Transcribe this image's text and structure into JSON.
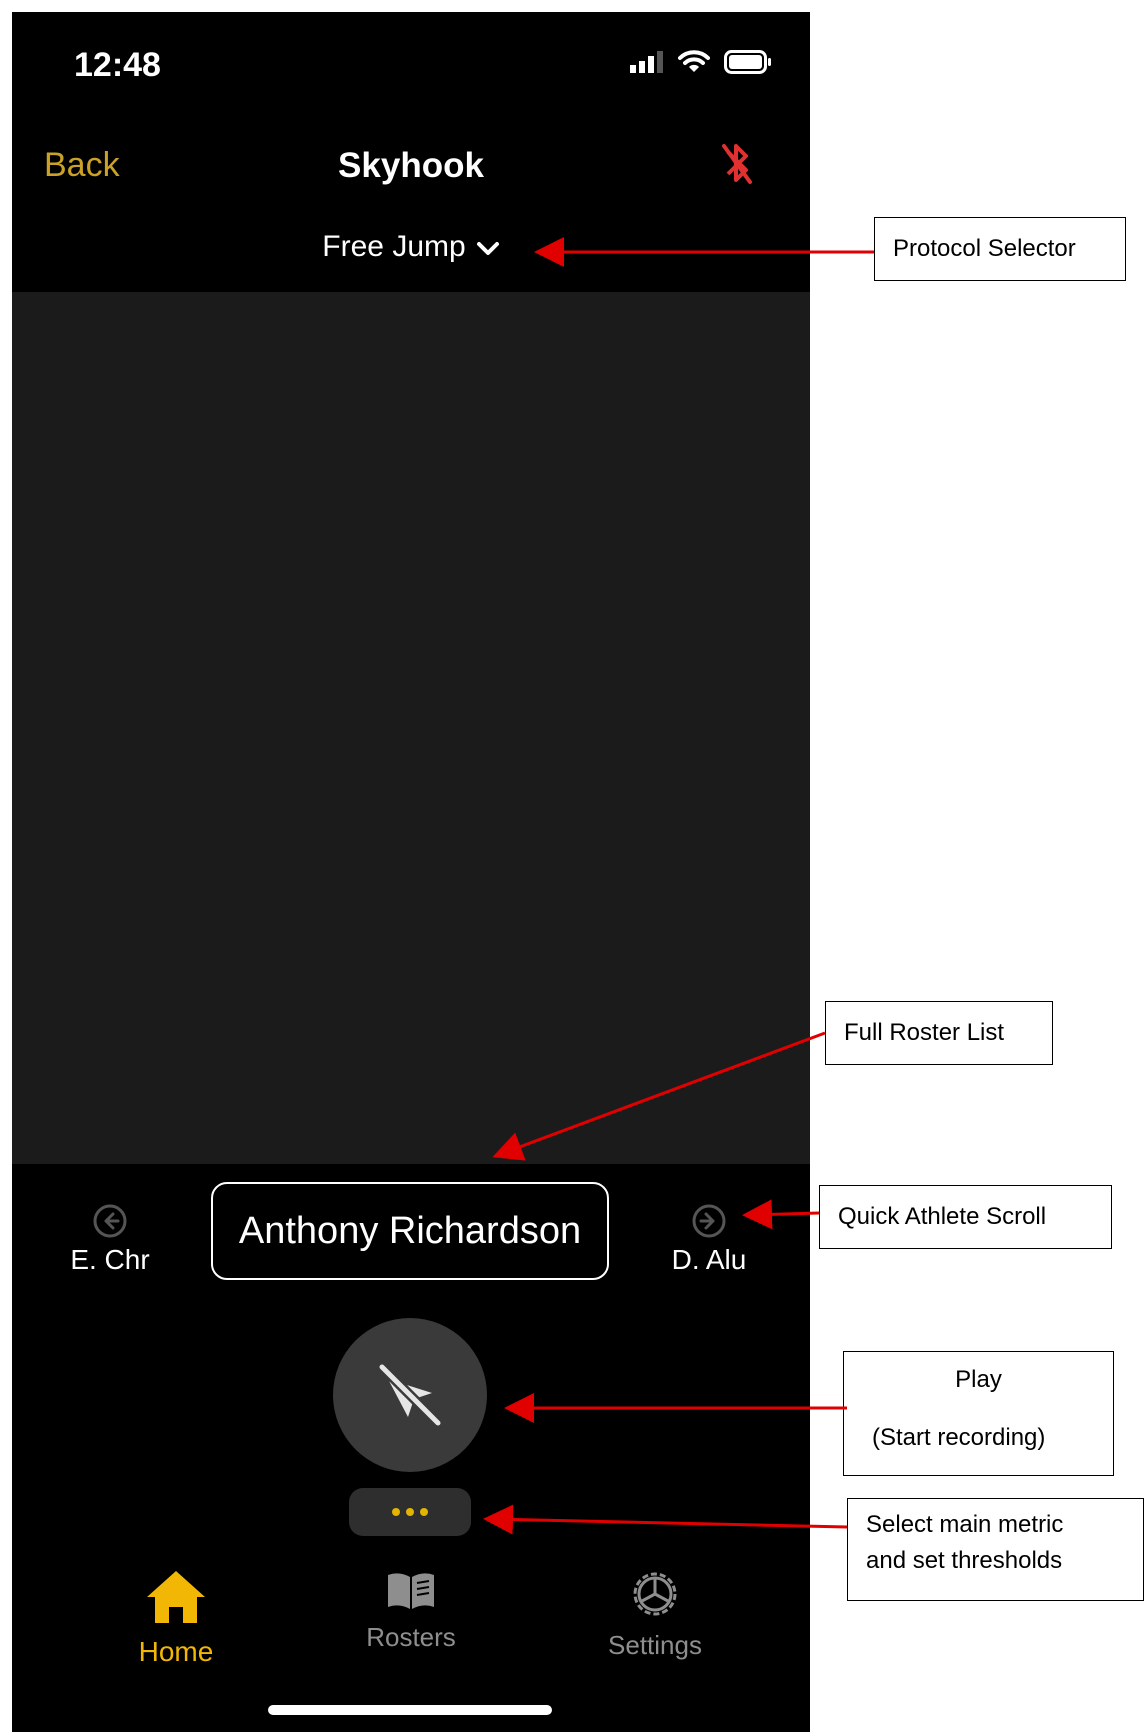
{
  "status_bar": {
    "time": "12:48"
  },
  "nav": {
    "back_label": "Back",
    "title": "Skyhook"
  },
  "protocol": {
    "label": "Free Jump"
  },
  "athletes": {
    "previous": "E. Chr",
    "current": "Anthony Richardson",
    "next": "D. Alu"
  },
  "tabs": [
    {
      "label": "Home",
      "icon": "home-icon",
      "active": true
    },
    {
      "label": "Rosters",
      "icon": "book-icon",
      "active": false
    },
    {
      "label": "Settings",
      "icon": "gear-icon",
      "active": false
    }
  ],
  "annotations": {
    "protocol_selector": "Protocol Selector",
    "full_roster": "Full Roster List",
    "quick_scroll": "Quick Athlete Scroll",
    "play_title": "Play",
    "play_sub": "(Start recording)",
    "metric_line1": "Select main metric",
    "metric_line2": "and set thresholds"
  },
  "colors": {
    "accent": "#c9a227",
    "active_tab": "#f2b705",
    "bluetooth_off": "#e03030",
    "annotation_arrow": "#e00000",
    "camera_bg": "#1b1b1b"
  }
}
